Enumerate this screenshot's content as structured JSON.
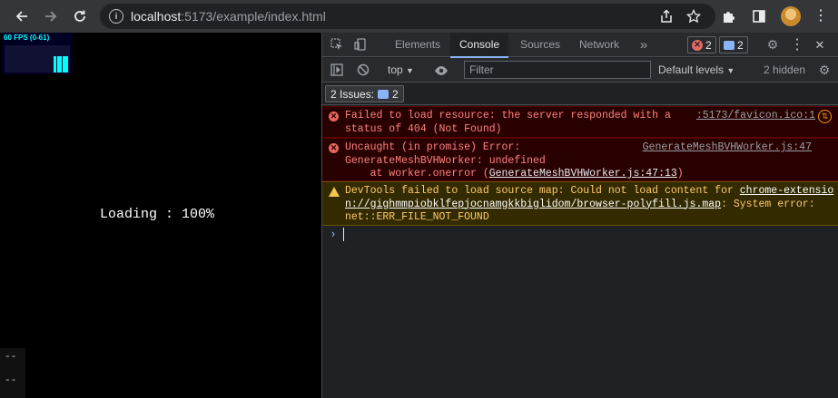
{
  "browser": {
    "url_host": "localhost",
    "url_rest": ":5173/example/index.html",
    "icons": [
      "back-arrow-icon",
      "forward-arrow-icon",
      "reload-icon",
      "info-icon",
      "share-icon",
      "star-icon",
      "extensions-icon",
      "side-panel-icon",
      "avatar",
      "kebab-menu-icon"
    ]
  },
  "page": {
    "fps_label": "60 FPS (0-61)",
    "loading_text": "Loading : 100%",
    "stat_lines": [
      "--",
      "--"
    ]
  },
  "devtools": {
    "tabs": [
      "Elements",
      "Console",
      "Sources",
      "Network"
    ],
    "active_tab": "Console",
    "more_tabs_glyph": "»",
    "error_count": "2",
    "message_count": "2",
    "context": "top",
    "filter_placeholder": "Filter",
    "levels": "Default levels",
    "hidden": "2 hidden",
    "issues_label": "2 Issues:",
    "issues_count": "2",
    "messages": [
      {
        "level": "error",
        "text": "Failed to load resource: the server responded with a\nstatus of 404 (Not Found)",
        "source": ":5173/favicon.ico:1"
      },
      {
        "level": "error",
        "text_line1": "Uncaught (in promise) Error:",
        "text_line2": "GenerateMeshBVHWorker: undefined",
        "text_line3_prefix": "    at worker.onerror (",
        "text_line3_link": "GenerateMeshBVHWorker.js:47:13",
        "text_line3_suffix": ")",
        "source": "GenerateMeshBVHWorker.js:47"
      },
      {
        "level": "warning",
        "text_prefix": "DevTools failed to load source map: Could not load content for ",
        "link_line1": "chrome-extensio",
        "link_line2": "n://gighmmpiobklfepjocnamgkkbiglidom/browser-polyfill.js.map",
        "text_suffix_line2": ": System error:",
        "text_line3": "net::ERR_FILE_NOT_FOUND"
      }
    ],
    "colors": {
      "error_bg": "#290000",
      "error_text": "#ff8080",
      "warning_bg": "#332a00",
      "warning_text": "#ffcb6b",
      "accent": "#8ab4f8"
    }
  }
}
